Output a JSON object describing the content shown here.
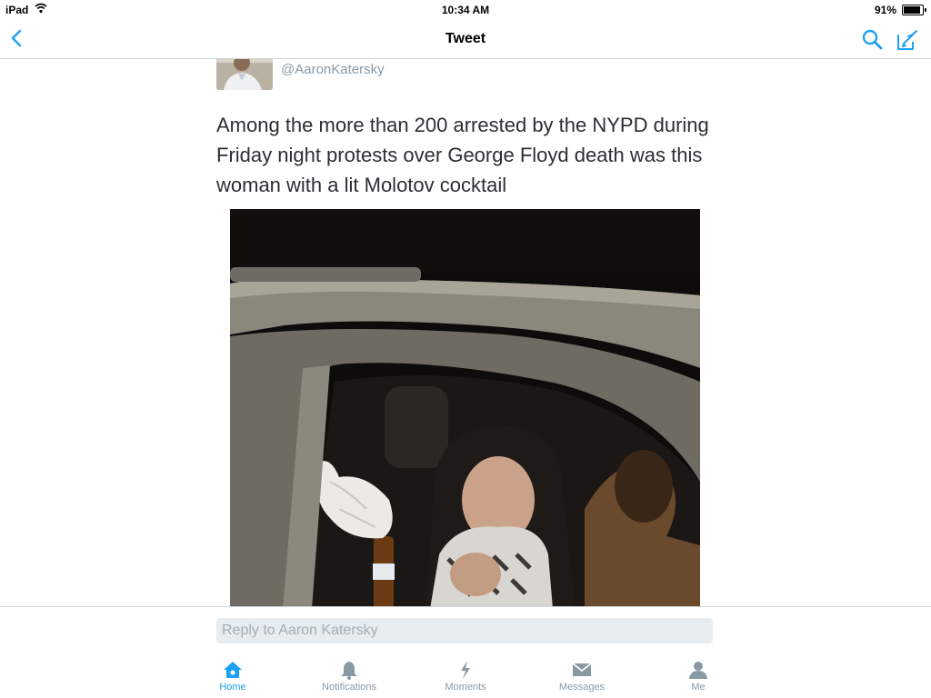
{
  "status_bar": {
    "device": "iPad",
    "time": "10:34 AM",
    "battery": "91%"
  },
  "nav": {
    "title": "Tweet"
  },
  "tweet": {
    "handle": "@AaronKatersky",
    "text": "Among the more than 200 arrested by the NYPD during Friday night protests over George Floyd death was this woman with a lit Molotov cocktail"
  },
  "reply": {
    "placeholder": "Reply to Aaron Katersky"
  },
  "tabs": [
    {
      "label": "Home",
      "icon": "home-icon"
    },
    {
      "label": "Notifications",
      "icon": "bell-icon"
    },
    {
      "label": "Moments",
      "icon": "lightning-icon"
    },
    {
      "label": "Messages",
      "icon": "envelope-icon"
    },
    {
      "label": "Me",
      "icon": "person-icon"
    }
  ],
  "colors": {
    "accent": "#1da1f2",
    "muted": "#8899a6",
    "text": "#292f33"
  }
}
